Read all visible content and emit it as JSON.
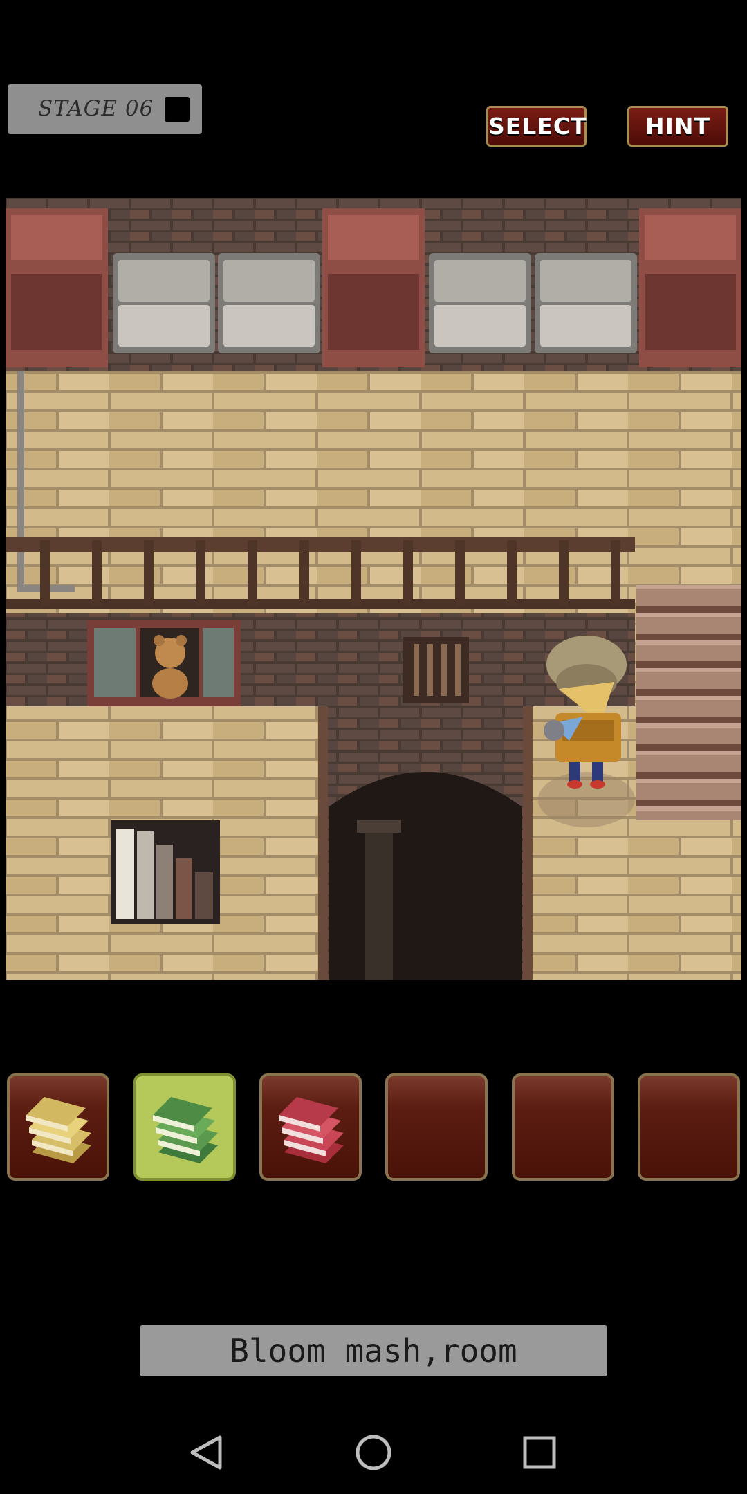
{
  "hud": {
    "stage_label": "STAGE 06",
    "select_label": "SELECT",
    "hint_label": "HINT"
  },
  "inventory": {
    "slots": [
      {
        "item": "yellow-books",
        "selected": false
      },
      {
        "item": "green-books",
        "selected": true
      },
      {
        "item": "red-books",
        "selected": false
      },
      {
        "item": "",
        "selected": false
      },
      {
        "item": "",
        "selected": false
      },
      {
        "item": "",
        "selected": false
      }
    ]
  },
  "message": {
    "text": "Bloom mash,room"
  },
  "colors": {
    "button_red": "#6a1610",
    "button_border": "#a98d4d",
    "selected_slot": "#b5c95a",
    "wall_tan": "#c9ae7e"
  }
}
